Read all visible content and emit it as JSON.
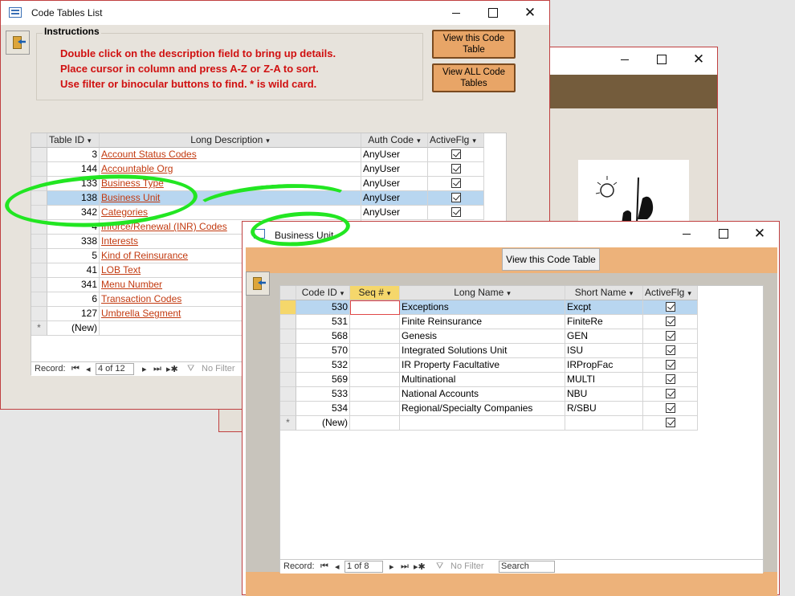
{
  "code_tables_window": {
    "title": "Code Tables List",
    "instructions_title": "Instructions",
    "instructions": [
      "Double click on the description field to bring up details.",
      "Place cursor in column and press A-Z or Z-A to sort.",
      "Use filter or binocular buttons to find.  * is wild card."
    ],
    "buttons": {
      "view_this": "View this Code Table",
      "view_all": "View ALL Code Tables"
    },
    "columns": [
      "Table ID",
      "Long Description",
      "Auth Code",
      "ActiveFlg"
    ],
    "rows": [
      {
        "id": "3",
        "desc": "Account Status Codes",
        "auth": "AnyUser"
      },
      {
        "id": "144",
        "desc": "Accountable Org",
        "auth": "AnyUser"
      },
      {
        "id": "133",
        "desc": "Business Type",
        "auth": "AnyUser"
      },
      {
        "id": "138",
        "desc": "Business Unit",
        "auth": "AnyUser"
      },
      {
        "id": "342",
        "desc": "Categories",
        "auth": "AnyUser"
      },
      {
        "id": "4",
        "desc": "Inforce/Renewal (INR) Codes",
        "auth": ""
      },
      {
        "id": "338",
        "desc": "Interests",
        "auth": ""
      },
      {
        "id": "5",
        "desc": "Kind of Reinsurance",
        "auth": ""
      },
      {
        "id": "41",
        "desc": "LOB Text",
        "auth": ""
      },
      {
        "id": "341",
        "desc": "Menu Number",
        "auth": ""
      },
      {
        "id": "6",
        "desc": "Transaction Codes",
        "auth": ""
      },
      {
        "id": "127",
        "desc": "Umbrella Segment",
        "auth": ""
      }
    ],
    "new_row": "(New)",
    "new_marker": "*",
    "nav": {
      "label": "Record:",
      "position": "4 of 12",
      "filter": "No Filter"
    }
  },
  "business_unit_window": {
    "title": "Business Unit",
    "button": "View this Code Table",
    "columns": [
      "Code ID",
      "Seq #",
      "Long Name",
      "Short Name",
      "ActiveFlg"
    ],
    "rows": [
      {
        "id": "530",
        "seq": "",
        "long": "Exceptions",
        "short": "Excpt"
      },
      {
        "id": "531",
        "seq": "",
        "long": "Finite Reinsurance",
        "short": "FiniteRe"
      },
      {
        "id": "568",
        "seq": "",
        "long": "Genesis",
        "short": "GEN"
      },
      {
        "id": "570",
        "seq": "",
        "long": "Integrated Solutions Unit",
        "short": "ISU"
      },
      {
        "id": "532",
        "seq": "",
        "long": "IR Property Facultative",
        "short": "IRPropFac"
      },
      {
        "id": "569",
        "seq": "",
        "long": "Multinational",
        "short": "MULTI"
      },
      {
        "id": "533",
        "seq": "",
        "long": "National Accounts",
        "short": "NBU"
      },
      {
        "id": "534",
        "seq": "",
        "long": "Regional/Specialty Companies",
        "short": "R/SBU"
      }
    ],
    "new_row": "(New)",
    "new_marker": "*",
    "nav": {
      "label": "Record:",
      "position": "1 of 8",
      "filter": "No Filter",
      "search": "Search"
    }
  },
  "colors": {
    "accent_orange": "#e8a567",
    "instruction_red": "#d01010",
    "selection_blue": "#b8d6f0",
    "highlight_green": "#22e622",
    "banner_brown": "#745c3c"
  }
}
